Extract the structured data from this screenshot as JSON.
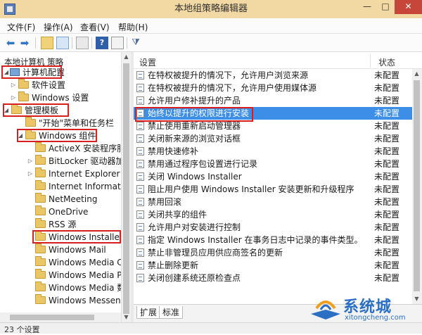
{
  "window": {
    "title": "本地组策略编辑器",
    "minimize": "—",
    "maximize": "□",
    "close": "✕"
  },
  "menu": [
    "文件(F)",
    "操作(A)",
    "查看(V)",
    "帮助(H)"
  ],
  "toolbar_icons": [
    "back-arrow-icon",
    "forward-arrow-icon",
    "up-folder-icon",
    "show-tree-icon",
    "export-list-icon",
    "help-icon",
    "properties-icon",
    "filter-icon"
  ],
  "tree": {
    "header": "本地计算机 策略",
    "items": [
      {
        "label": "计算机配置",
        "expanded": true,
        "highlighted": true
      },
      {
        "label": "软件设置",
        "expanded": false,
        "highlighted": false
      },
      {
        "label": "Windows 设置",
        "expanded": false,
        "highlighted": false
      },
      {
        "label": "管理模板",
        "expanded": true,
        "highlighted": true
      },
      {
        "label": "\"开始\"菜单和任务栏",
        "expanded": false,
        "highlighted": false
      },
      {
        "label": "Windows 组件",
        "expanded": true,
        "highlighted": true
      },
      {
        "label": "ActiveX 安装程序服务",
        "expanded": false,
        "highlighted": false
      },
      {
        "label": "BitLocker 驱动器加密",
        "expanded": false,
        "highlighted": false
      },
      {
        "label": "Internet Explorer",
        "expanded": false,
        "highlighted": false
      },
      {
        "label": "Internet Information Services",
        "expanded": false,
        "highlighted": false
      },
      {
        "label": "NetMeeting",
        "expanded": false,
        "highlighted": false
      },
      {
        "label": "OneDrive",
        "expanded": false,
        "highlighted": false
      },
      {
        "label": "RSS 源",
        "expanded": false,
        "highlighted": false
      },
      {
        "label": "Windows Installer",
        "expanded": false,
        "highlighted": true,
        "selected": true
      },
      {
        "label": "Windows Mail",
        "expanded": false,
        "highlighted": false
      },
      {
        "label": "Windows Media Center",
        "expanded": false,
        "highlighted": false
      },
      {
        "label": "Windows Media Player",
        "expanded": false,
        "highlighted": false
      },
      {
        "label": "Windows Media 数字权限管理",
        "expanded": false,
        "highlighted": false
      },
      {
        "label": "Windows Messenger",
        "expanded": false,
        "highlighted": false
      }
    ]
  },
  "list": {
    "columns": {
      "setting": "设置",
      "state": "状态"
    },
    "rows": [
      {
        "name": "在特权被提升的情况下，允许用户浏览来源",
        "state": "未配置",
        "selected": false
      },
      {
        "name": "在特权被提升的情况下，允许用户使用媒体源",
        "state": "未配置",
        "selected": false
      },
      {
        "name": "允许用户修补提升的产品",
        "state": "未配置",
        "selected": false
      },
      {
        "name": "始终以提升的权限进行安装",
        "state": "未配置",
        "selected": true
      },
      {
        "name": "禁止使用重新启动管理器",
        "state": "未配置",
        "selected": false
      },
      {
        "name": "关闭新来源的浏览对话框",
        "state": "未配置",
        "selected": false
      },
      {
        "name": "禁用快速修补",
        "state": "未配置",
        "selected": false
      },
      {
        "name": "禁用通过程序包设置进行记录",
        "state": "未配置",
        "selected": false
      },
      {
        "name": "关闭 Windows Installer",
        "state": "未配置",
        "selected": false
      },
      {
        "name": "阻止用户使用 Windows Installer 安装更新和升级程序",
        "state": "未配置",
        "selected": false
      },
      {
        "name": "禁用回滚",
        "state": "未配置",
        "selected": false
      },
      {
        "name": "关闭共享的组件",
        "state": "未配置",
        "selected": false
      },
      {
        "name": "允许用户对安装进行控制",
        "state": "未配置",
        "selected": false
      },
      {
        "name": "指定 Windows Installer 在事务日志中记录的事件类型。",
        "state": "未配置",
        "selected": false
      },
      {
        "name": "禁止非管理员应用供应商签名的更新",
        "state": "未配置",
        "selected": false
      },
      {
        "name": "禁止删除更新",
        "state": "未配置",
        "selected": false
      },
      {
        "name": "关闭创建系统还原检查点",
        "state": "未配置",
        "selected": false
      }
    ]
  },
  "tabs": [
    "扩展",
    "标准"
  ],
  "status": "23 个设置",
  "watermark": {
    "name": "系统城",
    "url": "xitongcheng.com"
  },
  "colors": {
    "highlight_box": "#d71f1f",
    "selected_row": "#3d8ee6",
    "titlebar": "#f2d8a3"
  }
}
